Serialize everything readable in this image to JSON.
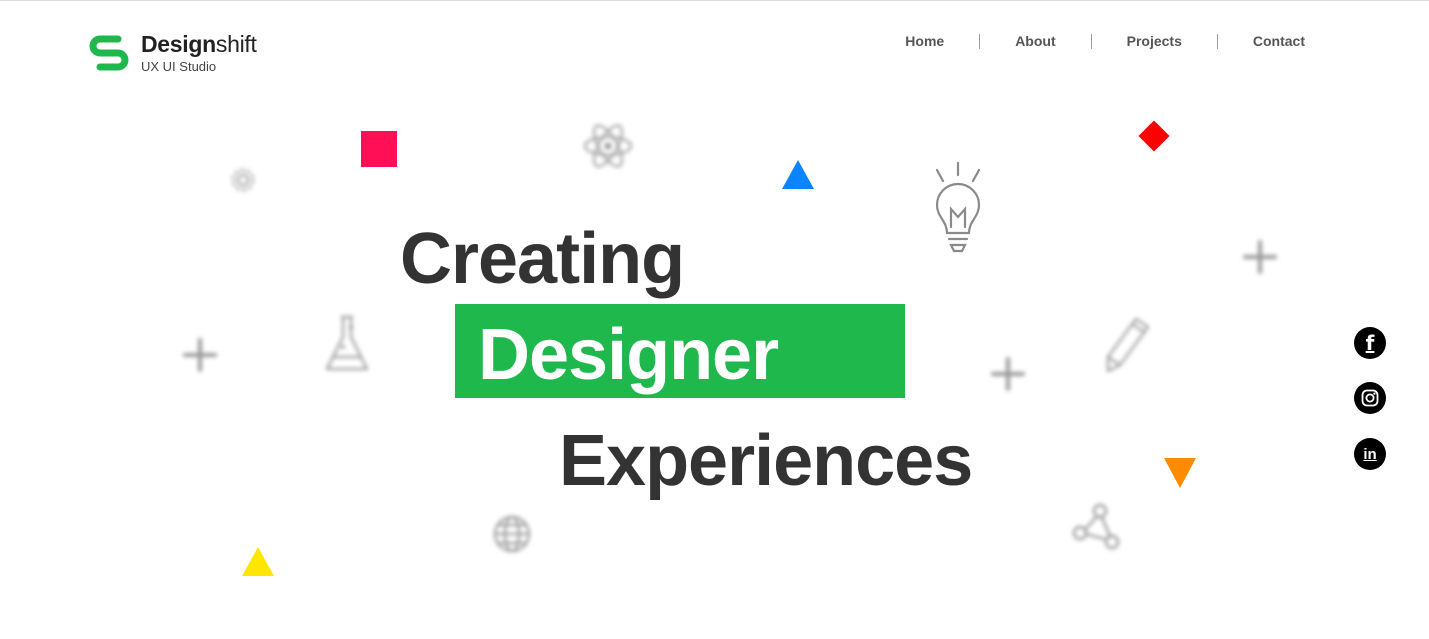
{
  "brand": {
    "name_bold": "Design",
    "name_light": "shift",
    "tagline": "UX UI Studio",
    "color": "#1fb84c"
  },
  "nav": [
    {
      "label": "Home"
    },
    {
      "label": "About"
    },
    {
      "label": "Projects"
    },
    {
      "label": "Contact"
    }
  ],
  "hero": {
    "line1": "Creating",
    "line2": "Designer",
    "line3": "Experiences",
    "highlight_color": "#1fb84c"
  },
  "decorations": [
    "gear-icon",
    "atom-icon",
    "lightbulb-icon",
    "flask-icon",
    "pencil-icon",
    "globe-icon",
    "share-icon",
    "plus-icon"
  ],
  "shape_colors": {
    "pink": "#ff0f55",
    "blue": "#0a84ff",
    "red": "#ff0000",
    "orange": "#ff8c00",
    "yellow": "#ffe600"
  },
  "social": [
    {
      "icon": "facebook-icon",
      "glyph": "f"
    },
    {
      "icon": "instagram-icon"
    },
    {
      "icon": "linkedin-icon",
      "glyph": "in"
    }
  ]
}
